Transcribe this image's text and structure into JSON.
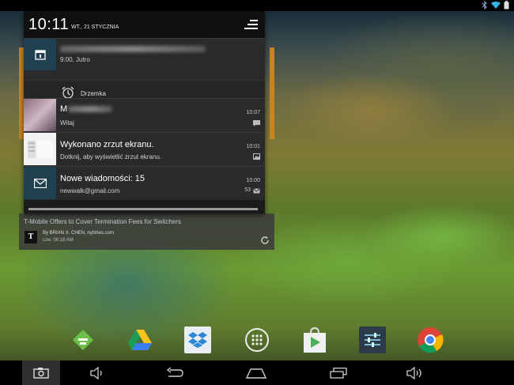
{
  "status_bar": {
    "icons": [
      "bluetooth-icon",
      "wifi-icon",
      "battery-icon"
    ]
  },
  "shade": {
    "clock": "10:11",
    "date": "WT., 21 STYCZNIA",
    "notifications": [
      {
        "id": "calendar",
        "icon": "calendar-icon",
        "title": "",
        "subtitle": "9:00, Jutro",
        "time": "",
        "extra": ""
      },
      {
        "id": "snooze",
        "label": "Drzemka",
        "icon": "alarm-clock-icon"
      },
      {
        "id": "message",
        "icon": "avatar",
        "title": "M",
        "subtitle": "Witaj",
        "time": "10:07",
        "extra": "chat-icon"
      },
      {
        "id": "screenshot",
        "icon": "screenshot-thumb",
        "title": "Wykonano zrzut ekranu.",
        "subtitle": "Dotknij, aby wyświetlić zrzut ekranu.",
        "time": "10:01",
        "extra": "image-icon"
      },
      {
        "id": "mail",
        "icon": "mail-icon",
        "title": "Nowe wiadomości: 15",
        "subtitle": "newwalk@gmail.com",
        "time": "10:00",
        "count": "53"
      }
    ]
  },
  "news_widget": {
    "headline": "T-Mobile Offers to Cover Termination Fees for Switchers",
    "byline": "By BRIAN X. CHEN, nytimes.com",
    "time": "czw. 06:18 AM",
    "logo": "𝕿"
  },
  "dock": [
    "feedly-icon",
    "google-drive-icon",
    "dropbox-icon",
    "apps-launcher-icon",
    "play-store-icon",
    "settings-app-icon",
    "chrome-icon"
  ],
  "nav_bar": [
    "screenshot-button",
    "volume-down-button",
    "back-button",
    "home-button",
    "recent-apps-button",
    "volume-up-button"
  ]
}
